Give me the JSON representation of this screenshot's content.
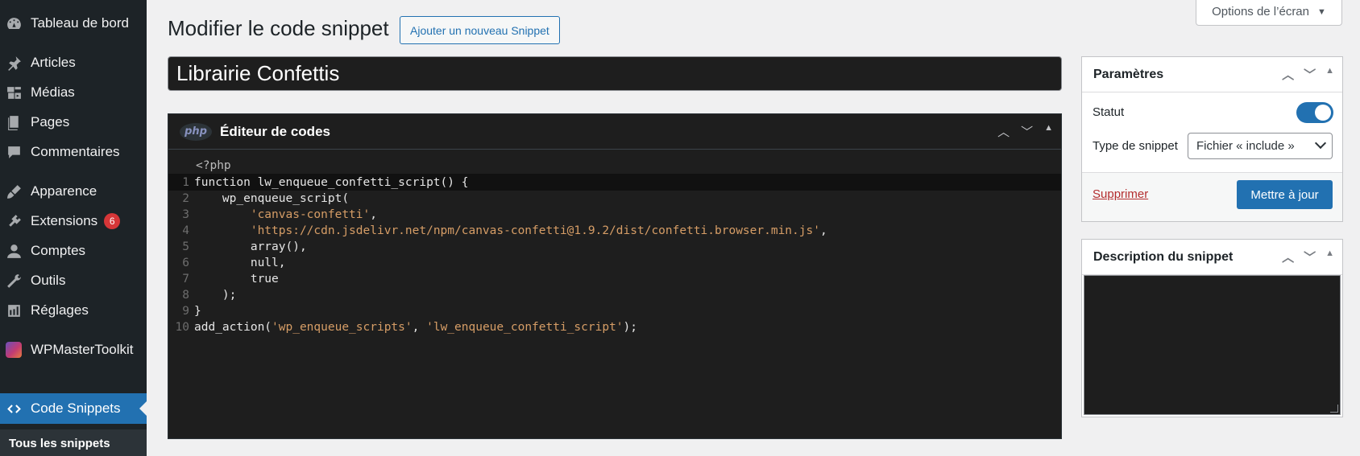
{
  "sidebar": {
    "items": [
      {
        "label": "Tableau de bord",
        "icon": "dashboard-icon"
      },
      {
        "label": "Articles",
        "icon": "pin-icon"
      },
      {
        "label": "Médias",
        "icon": "media-icon"
      },
      {
        "label": "Pages",
        "icon": "pages-icon"
      },
      {
        "label": "Commentaires",
        "icon": "comments-icon"
      },
      {
        "label": "Apparence",
        "icon": "appearance-icon"
      },
      {
        "label": "Extensions",
        "icon": "plugins-icon",
        "badge": "6"
      },
      {
        "label": "Comptes",
        "icon": "users-icon"
      },
      {
        "label": "Outils",
        "icon": "tools-icon"
      },
      {
        "label": "Réglages",
        "icon": "settings-icon"
      },
      {
        "label": "WPMasterToolkit",
        "icon": "wpmastertoolkit-icon"
      },
      {
        "label": "Code Snippets",
        "icon": "code-icon",
        "active": true
      }
    ],
    "submenu_label": "Tous les snippets"
  },
  "header": {
    "title": "Modifier le code snippet",
    "add_button": "Ajouter un nouveau Snippet",
    "screen_options": "Options de l’écran"
  },
  "snippet": {
    "title": "Librairie Confettis"
  },
  "editor": {
    "title": "Éditeur de codes",
    "php_logo": "php",
    "php_open": "<?php",
    "lines": [
      {
        "n": "1",
        "code": "function lw_enqueue_confetti_script() {"
      },
      {
        "n": "2",
        "code": "    wp_enqueue_script("
      },
      {
        "n": "3",
        "code": "        'canvas-confetti',"
      },
      {
        "n": "4",
        "code": "        'https://cdn.jsdelivr.net/npm/canvas-confetti@1.9.2/dist/confetti.browser.min.js',"
      },
      {
        "n": "5",
        "code": "        array(),"
      },
      {
        "n": "6",
        "code": "        null,"
      },
      {
        "n": "7",
        "code": "        true"
      },
      {
        "n": "8",
        "code": "    );"
      },
      {
        "n": "9",
        "code": "}"
      },
      {
        "n": "10",
        "code": "add_action('wp_enqueue_scripts', 'lw_enqueue_confetti_script');"
      }
    ]
  },
  "parametres": {
    "title": "Paramètres",
    "status_label": "Statut",
    "status_on": true,
    "type_label": "Type de snippet",
    "type_value": "Fichier « include »",
    "delete_label": "Supprimer",
    "update_label": "Mettre à jour"
  },
  "description": {
    "title": "Description du snippet",
    "value": ""
  },
  "colors": {
    "sidebar_bg": "#1d2327",
    "accent": "#2271b1",
    "badge": "#d63638",
    "editor_bg": "#1e1e1e",
    "string": "#d69d66"
  }
}
